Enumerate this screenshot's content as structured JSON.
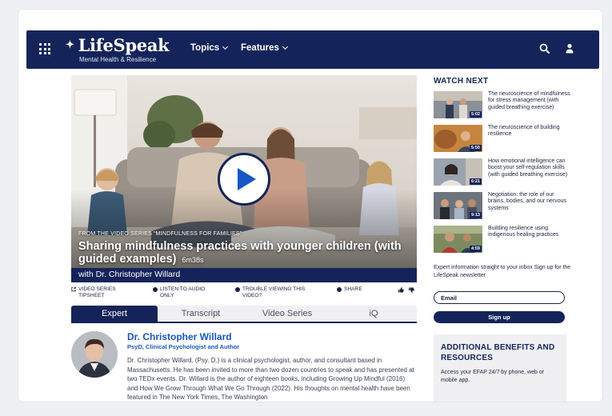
{
  "nav": {
    "logo": "LifeSpeak",
    "tagline": "Mental Health & Resilience",
    "links": [
      {
        "label": "Topics"
      },
      {
        "label": "Features"
      }
    ],
    "icons": [
      "menu-grid-icon",
      "search-icon",
      "user-icon"
    ]
  },
  "video": {
    "series_line": "FROM THE VIDEO SERIES “MINDFULNESS FOR FAMILIES”",
    "title": "Sharing mindfulness practices with younger children (with guided examples)",
    "duration": "6m38s",
    "presenter": "with Dr. Christopher Willard"
  },
  "actions": {
    "tipsheet": "VIDEO SERIES TIPSHEET",
    "audio": "LISTEN TO AUDIO ONLY",
    "trouble": "TROUBLE VIEWING THIS VIDEO?",
    "share": "SHARE"
  },
  "tabs": [
    {
      "label": "Expert",
      "active": true
    },
    {
      "label": "Transcript",
      "active": false
    },
    {
      "label": "Video Series",
      "active": false
    },
    {
      "label": "iQ",
      "active": false
    }
  ],
  "expert": {
    "name": "Dr. Christopher Willard",
    "credentials": "PsyD, Clinical Psychologist and Author",
    "bio": "Dr. Christopher Willard, (Psy. D.) is a clinical psychologist, author, and consultant based in Massachusetts. He has been invited to more than two dozen countries to speak and has presented at two TEDx events. Dr. Willard is the author of eighteen books, including Growing Up Mindful (2016) and How We Grow Through What We Go Through (2022). His thoughts on mental health have been featured in The New York Times, The Washington"
  },
  "watch_next": {
    "heading": "WATCH NEXT",
    "items": [
      {
        "title": "The neuroscience of mindfulness for stress management (with guided breathing exercise)",
        "duration": "5:02"
      },
      {
        "title": "The neuroscience of building resilience",
        "duration": "5:50"
      },
      {
        "title": "How emotional intelligence can boost your self-regulation skills (with guided breathing exercise)",
        "duration": "6:21"
      },
      {
        "title": "Negotiation: the role of our brains, bodies, and our nervous systems",
        "duration": "9:13"
      },
      {
        "title": "Building resilience using indigenous healing practices",
        "duration": "4:59"
      }
    ]
  },
  "newsletter": {
    "text": "Expert information straight to your inbox Sign up for the LifeSpeak newsletter",
    "email_placeholder": "Email",
    "button": "Sign up"
  },
  "benefits": {
    "heading": "ADDITIONAL BENEFITS AND RESOURCES",
    "text": "Access your EFAP 24/7 by phone, web or mobile app."
  },
  "colors": {
    "navy": "#14245a",
    "accent_blue": "#1856c7"
  }
}
